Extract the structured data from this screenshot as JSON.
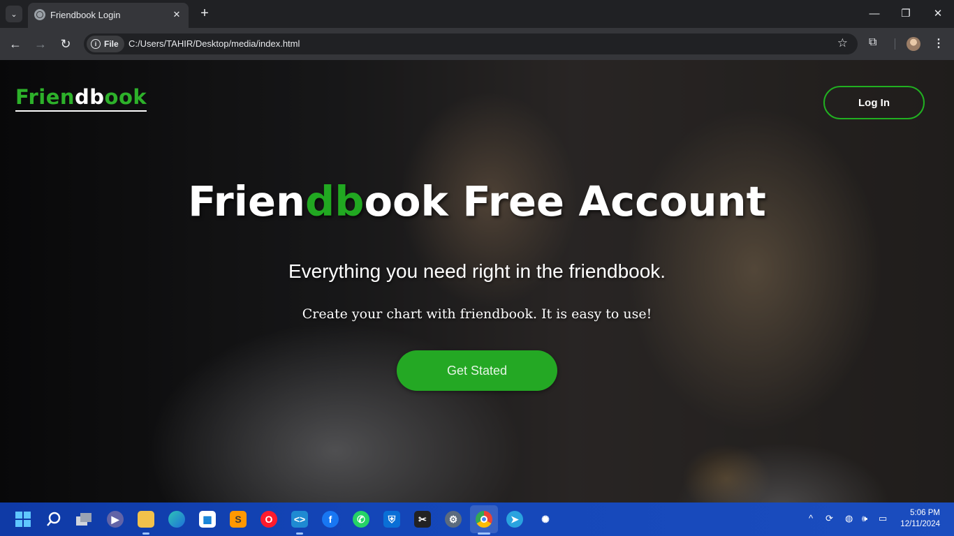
{
  "browser": {
    "tab_title": "Friendbook Login",
    "url_chip": "File",
    "url": "C:/Users/TAHIR/Desktop/media/index.html"
  },
  "page": {
    "logo": {
      "part1": "Frien",
      "part2": "db",
      "part3": "ook"
    },
    "login_label": "Log In",
    "headline": {
      "part1": "Frien",
      "part2": "db",
      "part3": "ook Free Account"
    },
    "subline": "Everything you need right in the friendbook.",
    "tagline": "Create your chart with friendbook. It is easy to use!",
    "cta_label": "Get Stated"
  },
  "taskbar": {
    "time": "5:06 PM",
    "date": "12/11/2024",
    "apps": [
      "start",
      "search",
      "task-view",
      "teams",
      "file-explorer",
      "edge",
      "store",
      "sublime-text",
      "opera",
      "vscode",
      "facebook",
      "whatsapp",
      "defender",
      "capcut",
      "settings",
      "chrome",
      "telegram",
      "chatgpt"
    ]
  },
  "colors": {
    "brand_green": "#21a821",
    "taskbar": "#1446b8"
  }
}
